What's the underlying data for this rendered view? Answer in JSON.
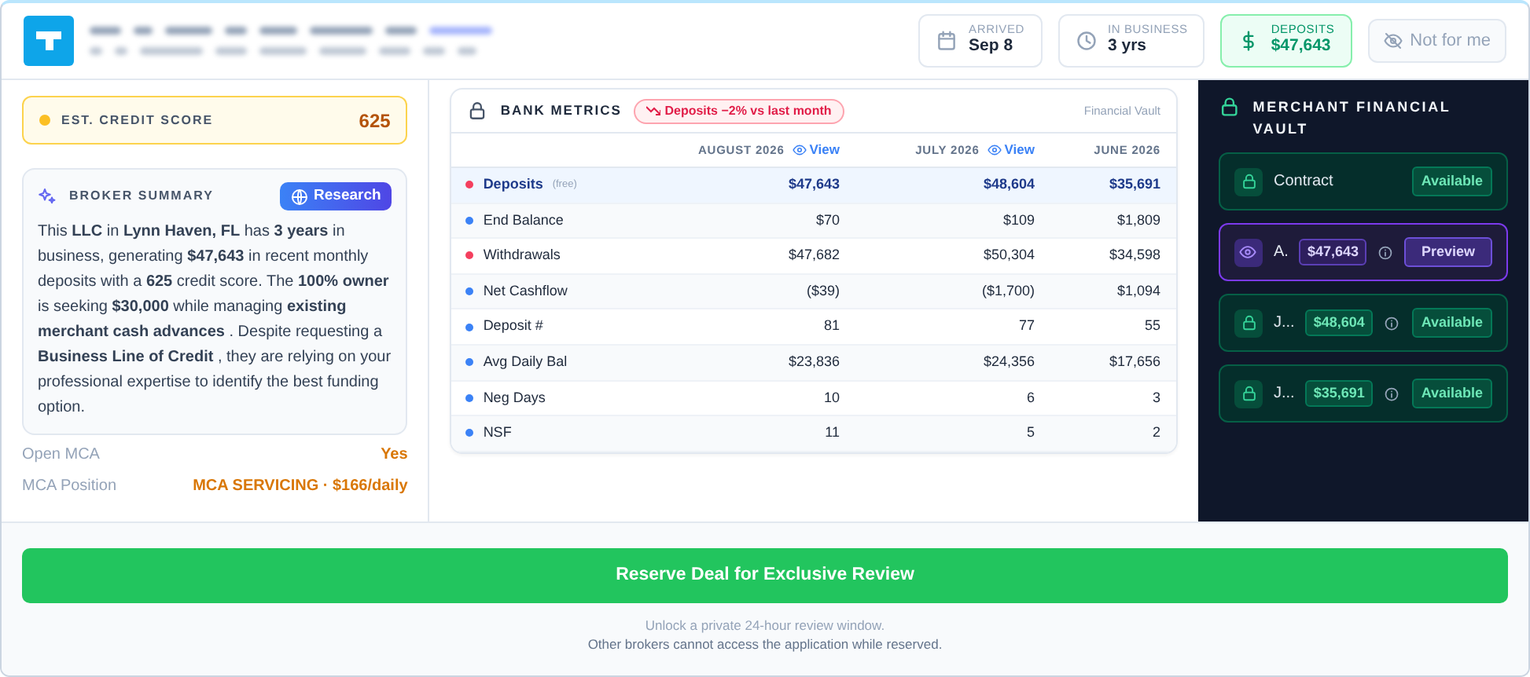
{
  "header": {
    "stats": [
      {
        "kind": "calendar",
        "label": "ARRIVED",
        "value": "Sep 8",
        "highlighted": false
      },
      {
        "kind": "clock",
        "label": "IN BUSINESS",
        "value": "3 yrs",
        "highlighted": false
      },
      {
        "kind": "dollar",
        "label": "DEPOSITS",
        "value": "$47,643",
        "highlighted": true
      }
    ],
    "dismiss_button": "Not for me"
  },
  "credit_score": {
    "label": "EST. CREDIT SCORE",
    "value": "625"
  },
  "broker_summary": {
    "title": "BROKER SUMMARY",
    "research_button": "Research",
    "text": "This **LLC** in **Lynn Haven, FL** has **3 years** in business, generating **$47,643** in recent monthly deposits with a **625** credit score. The **100% owner** is seeking **$30,000** while managing **existing merchant cash advances** . Despite requesting a **Business Line of Credit** , they are relying on your professional expertise to identify the best funding option."
  },
  "facts": [
    {
      "label": "Open MCA",
      "value": "Yes"
    },
    {
      "label": "MCA Position",
      "value": "MCA SERVICING · $166/daily"
    }
  ],
  "bank_metrics": {
    "title": "BANK METRICS",
    "trend_badge": "Deposits −2% vs last month",
    "source": "Financial Vault",
    "columns": [
      {
        "label": "AUGUST 2026",
        "view": "View"
      },
      {
        "label": "JULY 2026",
        "view": "View"
      },
      {
        "label": "JUNE 2026"
      }
    ],
    "rows": [
      {
        "label": "Deposits",
        "tag": "(free)",
        "color": "#f43f5e",
        "selected": true,
        "values": [
          "$47,643",
          "$48,604",
          "$35,691"
        ]
      },
      {
        "label": "End Balance",
        "color": "#3b82f6",
        "selected": false,
        "values": [
          "$70",
          "$109",
          "$1,809"
        ]
      },
      {
        "label": "Withdrawals",
        "color": "#f43f5e",
        "selected": false,
        "values": [
          "$47,682",
          "$50,304",
          "$34,598"
        ]
      },
      {
        "label": "Net Cashflow",
        "color": "#3b82f6",
        "selected": false,
        "values": [
          "($39)",
          "($1,700)",
          "$1,094"
        ]
      },
      {
        "label": "Deposit #",
        "color": "#3b82f6",
        "selected": false,
        "values": [
          "81",
          "77",
          "55"
        ]
      },
      {
        "label": "Avg Daily Bal",
        "color": "#3b82f6",
        "selected": false,
        "values": [
          "$23,836",
          "$24,356",
          "$17,656"
        ]
      },
      {
        "label": "Neg Days",
        "color": "#3b82f6",
        "selected": false,
        "values": [
          "10",
          "6",
          "3"
        ]
      },
      {
        "label": "NSF",
        "color": "#3b82f6",
        "selected": false,
        "values": [
          "11",
          "5",
          "2"
        ]
      }
    ]
  },
  "vault": {
    "title": "MERCHANT FINANCIAL VAULT",
    "items": [
      {
        "kind": "available",
        "label": "Contract",
        "button": "Available"
      },
      {
        "kind": "preview",
        "label": "A.",
        "amount": "$47,643",
        "button": "Preview"
      },
      {
        "kind": "available",
        "label": "J...",
        "amount": "$48,604",
        "button": "Available"
      },
      {
        "kind": "available",
        "label": "J...",
        "amount": "$35,691",
        "button": "Available"
      }
    ]
  },
  "reserve_button": "Reserve Deal for Exclusive Review",
  "footer_notes": [
    "Unlock a private 24-hour review window.",
    "Other brokers cannot access the application while reserved."
  ]
}
